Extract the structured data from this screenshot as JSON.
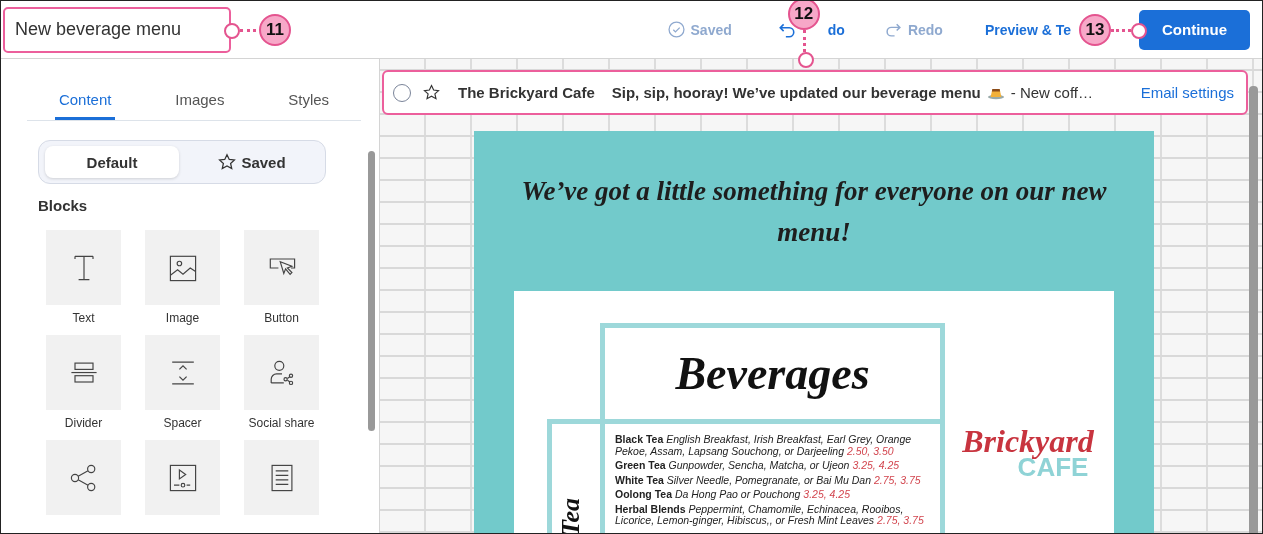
{
  "title_field": {
    "value": "New beverage menu"
  },
  "toolbar": [
    {
      "kind": "saved",
      "label": "Saved",
      "disabled": true
    },
    {
      "kind": "undo",
      "label": "do",
      "disabled": false
    },
    {
      "kind": "redo",
      "label": "Redo",
      "disabled": true
    },
    {
      "kind": "link",
      "label": "Preview & Te",
      "disabled": false
    }
  ],
  "continue_button": "Continue",
  "callouts": [
    {
      "number": "11"
    },
    {
      "number": "12"
    },
    {
      "number": "13"
    }
  ],
  "panel": {
    "tabs": [
      {
        "label": "Content",
        "selected": true
      },
      {
        "label": "Images",
        "selected": false
      },
      {
        "label": "Styles",
        "selected": false
      }
    ],
    "segments": [
      {
        "kind": "default",
        "label": "Default",
        "selected": true
      },
      {
        "kind": "saved",
        "label": "Saved",
        "selected": false
      }
    ],
    "section": "Blocks",
    "blocks": [
      {
        "kind": "text",
        "label": "Text"
      },
      {
        "kind": "image",
        "label": "Image"
      },
      {
        "kind": "button",
        "label": "Button"
      },
      {
        "kind": "divider",
        "label": "Divider"
      },
      {
        "kind": "spacer",
        "label": "Spacer"
      },
      {
        "kind": "social",
        "label": "Social share"
      },
      {
        "kind": "share"
      },
      {
        "kind": "video"
      },
      {
        "kind": "document"
      }
    ]
  },
  "email": {
    "selected": false,
    "starred": false,
    "sender": "The Brickyard Cafe",
    "subject": "Sip, sip, hooray! We’ve updated our beverage menu",
    "preview": "- New coff…",
    "settings_link": "Email settings",
    "headline": "We’ve got a little something for everyone on our new menu!",
    "menu": {
      "title": "Beverages",
      "side_label": "Tea",
      "items": [
        {
          "name": "Black Tea",
          "desc": "English Breakfast, Irish Breakfast, Earl Grey, Orange Pekoe, Assam, Lapsang Souchong, or Darjeeling",
          "prices": "2.50, 3.50"
        },
        {
          "name": "Green Tea",
          "desc": "Gunpowder, Sencha, Matcha, or Ujeon",
          "prices": "3.25, 4.25"
        },
        {
          "name": "White Tea",
          "desc": "Silver Needle, Pomegranate, or Bai Mu Dan",
          "prices": "2.75, 3.75"
        },
        {
          "name": "Oolong Tea",
          "desc": "Da Hong Pao or Pouchong",
          "prices": "3.25, 4.25"
        },
        {
          "name": "Herbal Blends",
          "desc": "Peppermint, Chamomile, Echinacea, Rooibos, Licorice, Lemon-ginger, Hibiscus,, or Fresh Mint Leaves",
          "prices": "2.75, 3.75"
        }
      ],
      "logo": {
        "line1": "Brickyard",
        "line2": "CAFE"
      }
    }
  }
}
